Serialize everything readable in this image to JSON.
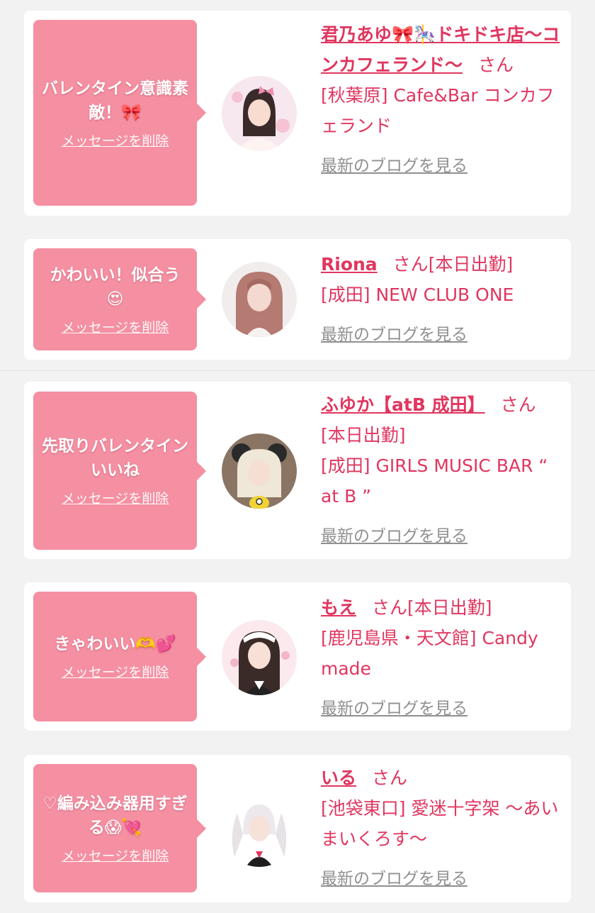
{
  "colors": {
    "bubble": "#f58fa2",
    "name": "#e0365f",
    "link_gray": "#909090",
    "page_bg": "#f2f2f2"
  },
  "common": {
    "delete_label": "メッセージを削除",
    "blog_label": "最新のブログを見る",
    "san": "さん"
  },
  "items": [
    {
      "message": "バレンタイン意識素敵！🎀",
      "name": "君乃あゆ🎀🎠ドキドキ店〜コンカフェランド〜",
      "status": "",
      "shop": "[秋葉原] Cafe&Bar コンカフェランド",
      "avatar_icon": "girl-avatar-pink-bow"
    },
    {
      "message": "かわいい！似合う😍",
      "name": "Riona",
      "status": "[本日出勤]",
      "shop": "[成田] NEW CLUB ONE",
      "avatar_icon": "girl-avatar-brown-hair"
    },
    {
      "message": "先取りバレンタインいいね",
      "name": "ふゆか【atB 成田】",
      "status": "[本日出勤]",
      "shop": "[成田] GIRLS MUSIC BAR “ at B ”",
      "avatar_icon": "girl-avatar-blonde-mouse-ears"
    },
    {
      "message": "きゃわいい🫶💕",
      "name": "もえ",
      "status": "[本日出勤]",
      "shop": "[鹿児島県・天文館] Candy made",
      "avatar_icon": "girl-avatar-maid"
    },
    {
      "message": "♡編み込み器用すぎる😱💘",
      "name": "いる",
      "status": "",
      "shop": "[池袋東口] 愛迷十字架 〜あいまいくろす〜",
      "avatar_icon": "girl-avatar-silver-twintails"
    }
  ]
}
